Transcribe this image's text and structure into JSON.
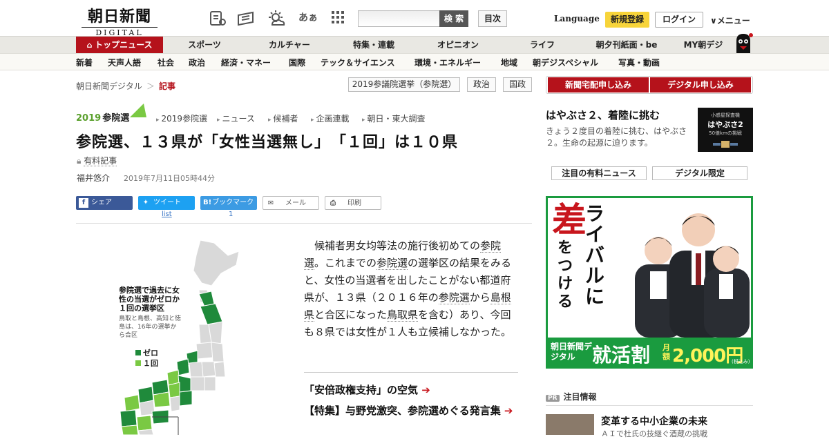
{
  "header": {
    "logo_main": "朝日新聞",
    "logo_sub": "DIGITAL",
    "icons": [
      "reader-icon",
      "newspaper-icon",
      "weather-icon",
      "font-size-icon",
      "grid-icon"
    ],
    "font_icon_text": "あぁ",
    "search_placeholder": "",
    "search_label": "検 索",
    "toc_label": "目次",
    "language_label": "Language",
    "register_label": "新規登録",
    "login_label": "ログイン",
    "menu_label": "∨メニュー"
  },
  "nav_primary": [
    "トップニュース",
    "スポーツ",
    "カルチャー",
    "特集・連載",
    "オピニオン",
    "ライフ",
    "朝夕刊紙面・be",
    "MY朝デジ"
  ],
  "nav_secondary": [
    "新着",
    "天声人語",
    "社会",
    "政治",
    "経済・マネー",
    "国際",
    "テック＆サイエンス",
    "環境・エネルギー",
    "地域",
    "朝デジスペシャル",
    "写真・動画"
  ],
  "breadcrumb": {
    "home": "朝日新聞デジタル",
    "sep": "＞",
    "current": "記事"
  },
  "tags": [
    "2019参議院選挙（参院選）",
    "政治",
    "国政"
  ],
  "election": {
    "logo_year": "2019",
    "logo_text": "参院選",
    "subnav": [
      "2019参院選",
      "ニュース",
      "候補者",
      "企画連載",
      "朝日・東大調査"
    ]
  },
  "article": {
    "title": "参院選、１３県が「女性当選無し」　「１回」は１０県",
    "paid_label": "有料記事",
    "author": "福井悠介",
    "date": "2019年7月11日05時44分",
    "body_parts": {
      "p1": "　候補者男女均等法の施行後初めての",
      "k1": "参院選",
      "p2": "。これまでの",
      "k2": "参院選",
      "p3": "の選挙区の結果をみると、女性の当選者を出したことがない都道府県が、１３県（２０１６年の",
      "k3": "参院選",
      "p4": "から",
      "k4": "島根県",
      "p5": "と合区になった",
      "k5": "鳥取県",
      "p6": "を含む）あり、今回も８県では女性が１人も立候補しなかった。"
    },
    "related": [
      "「安倍政権支持」の空気",
      "【特集】与野党激突、参院選めぐる発言集"
    ]
  },
  "share": {
    "facebook": "シェア",
    "twitter": "ツイート",
    "hatena": "ブックマーク",
    "hatena_mark": "B!",
    "mail": "メール",
    "print": "印刷",
    "twitter_count": "list",
    "hatena_count": "1"
  },
  "map": {
    "legend_title": "参院選で過去に女性の当選がゼロか１回の選挙区",
    "legend_note": "鳥取と島根、高知と徳島は、16年の選挙から合区",
    "legend_zero": "ゼロ",
    "legend_one": "１回",
    "color_zero": "#1f8a3b",
    "color_one": "#7ac943",
    "color_other": "#d9d9d9"
  },
  "sidebar": {
    "subscribe_paper": "新聞宅配申し込み",
    "subscribe_digital": "デジタル申し込み",
    "hayabusa_title": "はやぶさ２、着陸に挑む",
    "hayabusa_desc": "きょう２度目の着陸に挑む、はやぶさ２。生命の起源に迫ります。",
    "hayabusa_img_title": "はやぶさ2",
    "hayabusa_img_small": "小惑星探査機",
    "hayabusa_img_sub": "50億kmの挑戦",
    "tab_paid": "注目の有料ニュース",
    "tab_digital": "デジタル限定",
    "ad_slogan_1": "差",
    "ad_slogan_2": "をつける",
    "ad_slogan_3": "ライバルに",
    "ad_brand": "朝日新聞デジタル",
    "ad_campaign": "就活割",
    "ad_price_prefix": "月額",
    "ad_price": "2,000円",
    "ad_tax": "(税込み)",
    "pr_tag": "PR",
    "pr_label": "注目情報",
    "pr_title": "変革する中小企業の未来",
    "pr_sub": "ＡＩで杜氏の技継ぐ酒蔵の挑戦"
  }
}
